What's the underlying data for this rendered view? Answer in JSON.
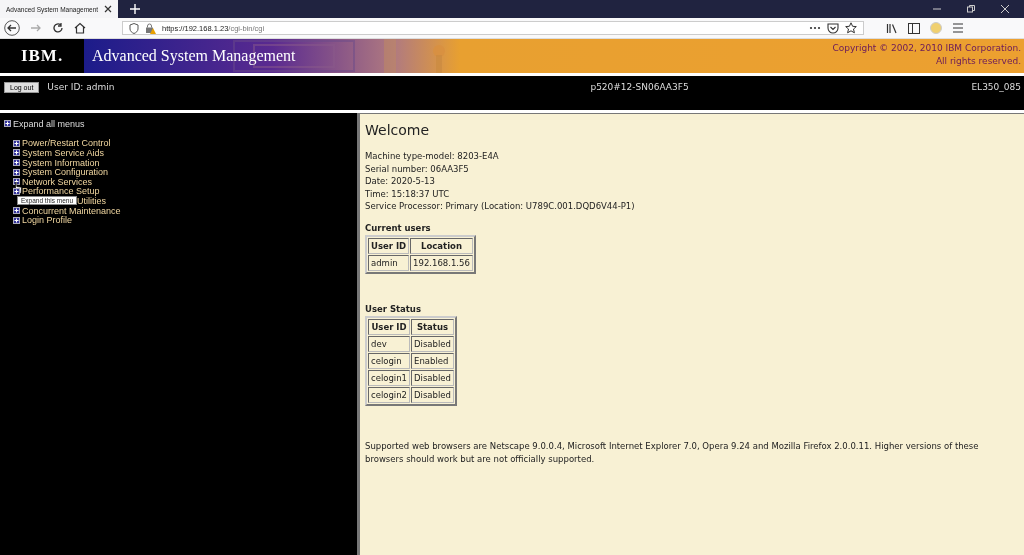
{
  "browser": {
    "tab_title": "Advanced System Management",
    "url_host": "https://192.168.1.23",
    "url_path": "/cgi-bin/cgi"
  },
  "banner": {
    "logo": "IBM.",
    "title": "Advanced System Management",
    "copyright": [
      "Copyright © 2002, 2010 IBM Corporation.",
      "All rights reserved."
    ]
  },
  "header": {
    "logout_button": "Log out",
    "user": "User ID: admin",
    "system": "p520#12-SN06AA3F5",
    "firmware": "EL350_085"
  },
  "menu": {
    "expand_all": "Expand all menus",
    "items": [
      {
        "label": "Power/Restart Control"
      },
      {
        "label": "System Service Aids"
      },
      {
        "label": "System Information"
      },
      {
        "label": "System Configuration"
      },
      {
        "label": "Network Services",
        "pointer": true
      },
      {
        "label": "Performance Setup"
      },
      {
        "label": "Utilities",
        "tooltip": "Expand this menu"
      },
      {
        "label": "Concurrent Maintenance"
      },
      {
        "label": "Login Profile"
      }
    ]
  },
  "welcome": {
    "title": "Welcome",
    "info": [
      "Machine type-model: 8203-E4A",
      "Serial number: 06AA3F5",
      "Date: 2020-5-13",
      "Time: 15:18:37 UTC",
      "Service Processor: Primary (Location: U789C.001.DQD6V44-P1)"
    ],
    "tables": [
      {
        "title": "Current users",
        "columns": [
          "User ID",
          "Location"
        ],
        "rows": [
          [
            "admin",
            "192.168.1.56"
          ]
        ]
      },
      {
        "title": "User Status",
        "columns": [
          "User ID",
          "Status"
        ],
        "rows": [
          [
            "dev",
            "Disabled"
          ],
          [
            "celogin",
            "Enabled"
          ],
          [
            "celogin1",
            "Disabled"
          ],
          [
            "celogin2",
            "Disabled"
          ]
        ]
      }
    ],
    "note": "Supported web browsers are Netscape 9.0.0.4, Microsoft Internet Explorer 7.0, Opera 9.24 and Mozilla Firefox 2.0.0.11. Higher versions of these browsers should work but are not officially supported."
  }
}
